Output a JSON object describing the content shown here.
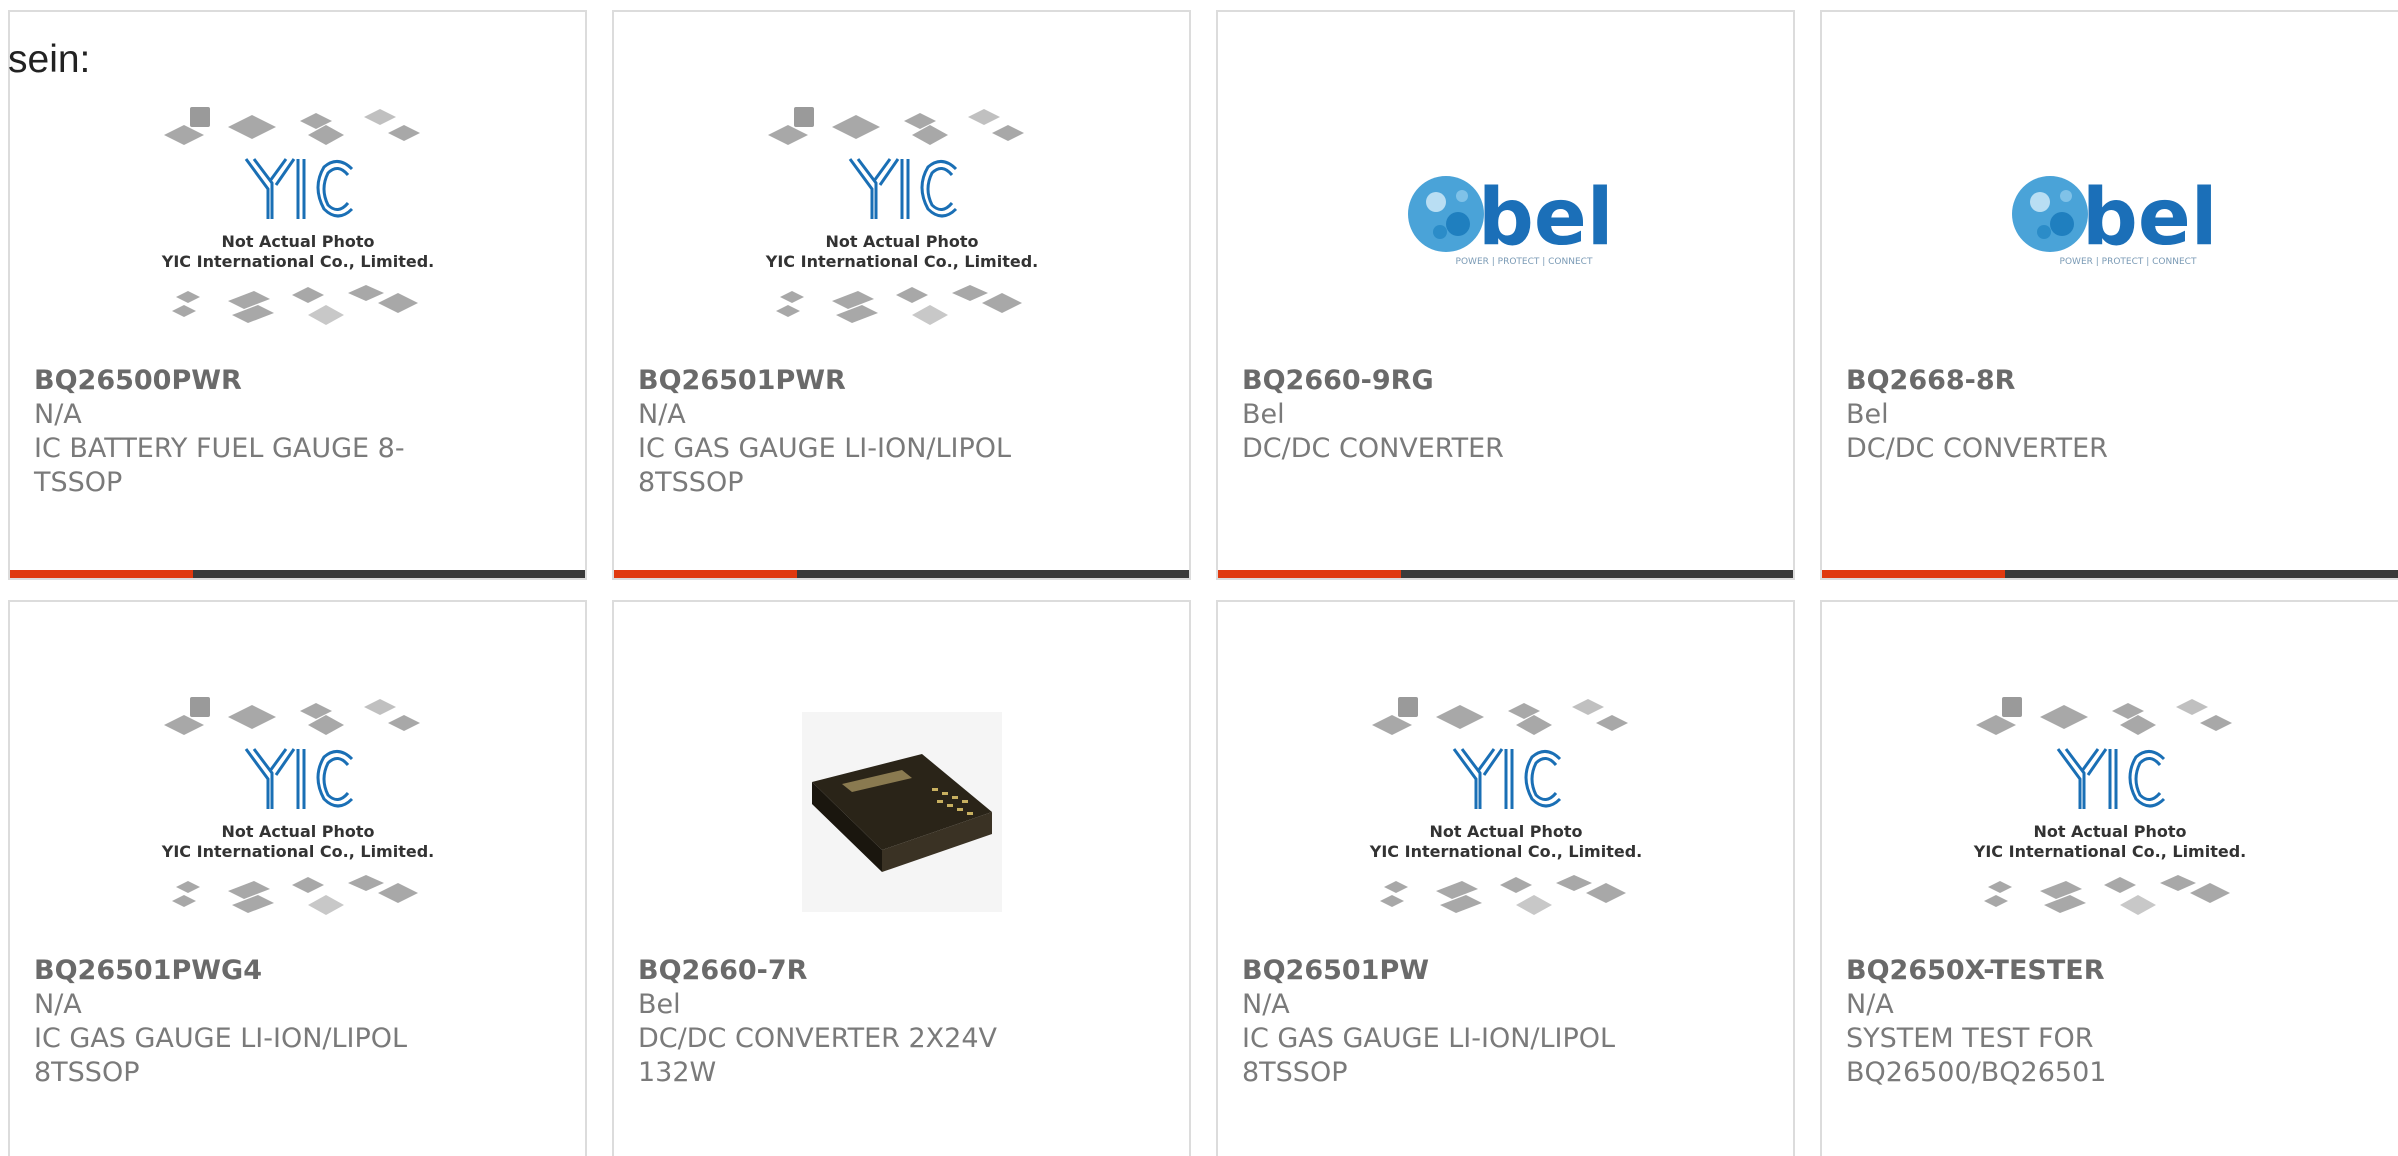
{
  "header": {
    "label": "sein:"
  },
  "colors": {
    "accent_bar": "#e0390f",
    "dark_bar": "#3a3a3a",
    "card_border": "#dcdcdc",
    "text_gray": "#7a7a7a",
    "yic_blue": "#1a6fb5",
    "bel_blue": "#1b6fb8"
  },
  "placeholder_logo": {
    "brand": "YIC",
    "line1": "Not Actual Photo",
    "line2": "YIC International Co., Limited."
  },
  "bel_logo": {
    "brand": "bel",
    "tagline": "POWER | PROTECT | CONNECT"
  },
  "products": [
    {
      "part": "BQ26500PWR",
      "manufacturer": "N/A",
      "description": "IC BATTERY FUEL GAUGE 8-TSSOP",
      "image": "yic-placeholder"
    },
    {
      "part": "BQ26501PWR",
      "manufacturer": "N/A",
      "description": "IC GAS GAUGE LI-ION/LIPOL 8TSSOP",
      "image": "yic-placeholder"
    },
    {
      "part": "BQ2660-9RG",
      "manufacturer": "Bel",
      "description": "DC/DC CONVERTER",
      "image": "bel-logo"
    },
    {
      "part": "BQ2668-8R",
      "manufacturer": "Bel",
      "description": "DC/DC CONVERTER",
      "image": "bel-logo"
    },
    {
      "part": "BQ26501PWG4",
      "manufacturer": "N/A",
      "description": "IC GAS GAUGE LI-ION/LIPOL 8TSSOP",
      "image": "yic-placeholder"
    },
    {
      "part": "BQ2660-7R",
      "manufacturer": "Bel",
      "description": "DC/DC CONVERTER 2X24V 132W",
      "image": "converter-photo"
    },
    {
      "part": "BQ26501PW",
      "manufacturer": "N/A",
      "description": "IC GAS GAUGE LI-ION/LIPOL 8TSSOP",
      "image": "yic-placeholder"
    },
    {
      "part": "BQ2650X-TESTER",
      "manufacturer": "N/A",
      "description": "SYSTEM TEST FOR BQ26500/BQ26501",
      "image": "yic-placeholder"
    }
  ]
}
